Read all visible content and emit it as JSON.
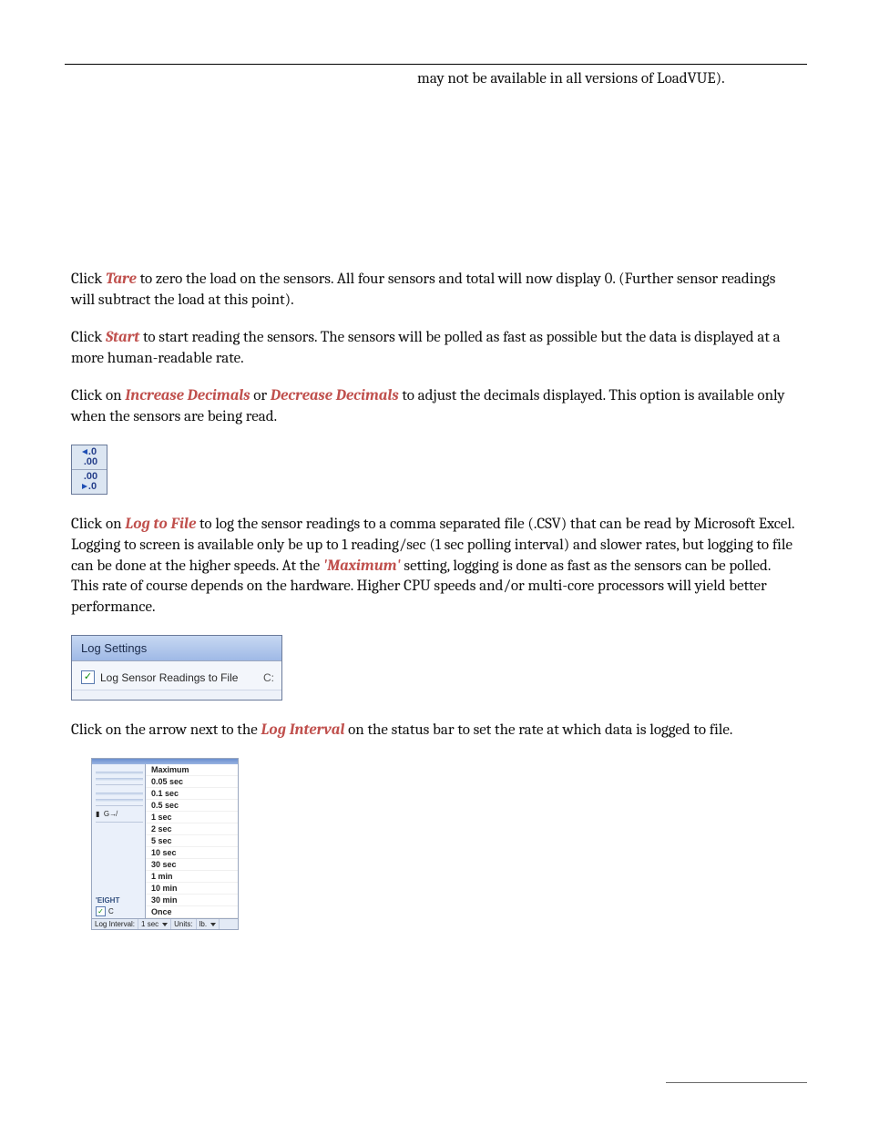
{
  "header": {
    "note": "may not be available in all versions of LoadVUE)."
  },
  "paragraphs": {
    "tare": {
      "pre": "Click ",
      "cmd": "Tare",
      "post": " to zero the load on the sensors. All four sensors and total will now display 0. (Further sensor readings will subtract the load at this point)."
    },
    "start": {
      "pre": "Click ",
      "cmd": "Start",
      "post": " to start reading the sensors. The sensors will be polled as fast as possible but the data is displayed at a more human-readable rate."
    },
    "decimals": {
      "pre": "Click on ",
      "cmd1": "Increase Decimals",
      "mid": " or ",
      "cmd2": "Decrease Decimals",
      "post": " to adjust the decimals displayed. This option is available only when the sensors are being read."
    },
    "logfile": {
      "pre": "Click on ",
      "cmd": "Log to File",
      "mid": " to log the sensor readings to a comma separated file (.CSV) that can be read by Microsoft Excel. Logging to screen is available only be up to 1 reading/sec (1 sec polling interval) and slower rates, but logging to file can be done at the higher speeds. At the ",
      "cmd2": "'Maximum'",
      "post": " setting, logging is done as fast as the sensors can be polled. This rate of course depends on the hardware. Higher CPU speeds and/or multi-core processors will yield better performance."
    },
    "loginterval": {
      "pre": "Click on the arrow next to the ",
      "cmd": "Log Interval",
      "post": " on the status bar to set the rate at which data is logged to file."
    }
  },
  "decimals_icons": {
    "inc": "←.0\n .00",
    "dec": " .00\n→.0"
  },
  "log_settings": {
    "title": "Log Settings",
    "checkbox_label": "Log Sensor Readings to File",
    "path_stub": "C:"
  },
  "interval_menu": {
    "items": [
      "Maximum",
      "0.05 sec",
      "0.1 sec",
      "0.5 sec",
      "1 sec",
      "2 sec",
      "5 sec",
      "10 sec",
      "30 sec",
      "1 min",
      "10 min",
      "30 min",
      "Once"
    ],
    "left_label": "'EIGHT",
    "status": {
      "label": "Log Interval:",
      "value": "1 sec",
      "units_label": "Units:",
      "units_value": "lb."
    }
  }
}
